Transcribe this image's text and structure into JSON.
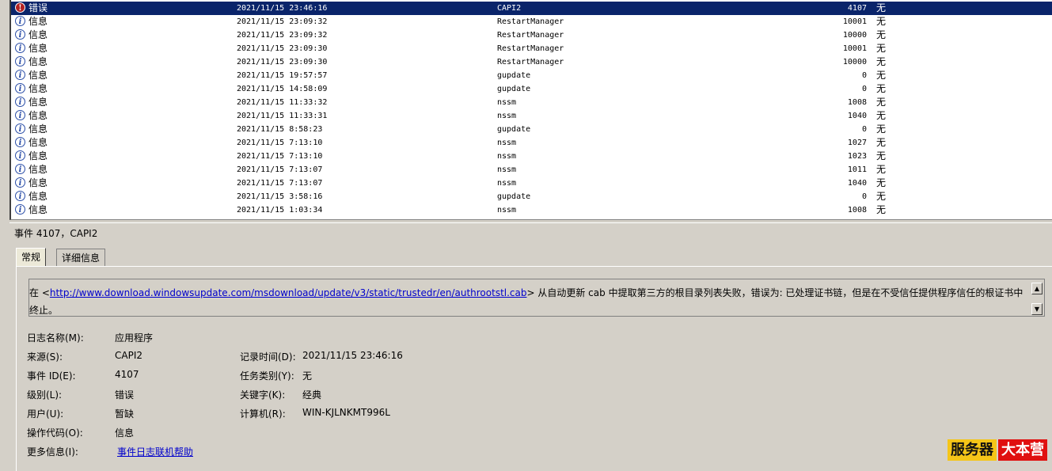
{
  "events": [
    {
      "level": "错误",
      "level_type": "error",
      "date": "2021/11/15 23:46:16",
      "source": "CAPI2",
      "id": "4107",
      "task": "无",
      "selected": true
    },
    {
      "level": "信息",
      "level_type": "info",
      "date": "2021/11/15 23:09:32",
      "source": "RestartManager",
      "id": "10001",
      "task": "无"
    },
    {
      "level": "信息",
      "level_type": "info",
      "date": "2021/11/15 23:09:32",
      "source": "RestartManager",
      "id": "10000",
      "task": "无"
    },
    {
      "level": "信息",
      "level_type": "info",
      "date": "2021/11/15 23:09:30",
      "source": "RestartManager",
      "id": "10001",
      "task": "无"
    },
    {
      "level": "信息",
      "level_type": "info",
      "date": "2021/11/15 23:09:30",
      "source": "RestartManager",
      "id": "10000",
      "task": "无"
    },
    {
      "level": "信息",
      "level_type": "info",
      "date": "2021/11/15 19:57:57",
      "source": "gupdate",
      "id": "0",
      "task": "无"
    },
    {
      "level": "信息",
      "level_type": "info",
      "date": "2021/11/15 14:58:09",
      "source": "gupdate",
      "id": "0",
      "task": "无"
    },
    {
      "level": "信息",
      "level_type": "info",
      "date": "2021/11/15 11:33:32",
      "source": "nssm",
      "id": "1008",
      "task": "无"
    },
    {
      "level": "信息",
      "level_type": "info",
      "date": "2021/11/15 11:33:31",
      "source": "nssm",
      "id": "1040",
      "task": "无"
    },
    {
      "level": "信息",
      "level_type": "info",
      "date": "2021/11/15 8:58:23",
      "source": "gupdate",
      "id": "0",
      "task": "无"
    },
    {
      "level": "信息",
      "level_type": "info",
      "date": "2021/11/15 7:13:10",
      "source": "nssm",
      "id": "1027",
      "task": "无"
    },
    {
      "level": "信息",
      "level_type": "info",
      "date": "2021/11/15 7:13:10",
      "source": "nssm",
      "id": "1023",
      "task": "无"
    },
    {
      "level": "信息",
      "level_type": "info",
      "date": "2021/11/15 7:13:07",
      "source": "nssm",
      "id": "1011",
      "task": "无"
    },
    {
      "level": "信息",
      "level_type": "info",
      "date": "2021/11/15 7:13:07",
      "source": "nssm",
      "id": "1040",
      "task": "无"
    },
    {
      "level": "信息",
      "level_type": "info",
      "date": "2021/11/15 3:58:16",
      "source": "gupdate",
      "id": "0",
      "task": "无"
    },
    {
      "level": "信息",
      "level_type": "info",
      "date": "2021/11/15 1:03:34",
      "source": "nssm",
      "id": "1008",
      "task": "无"
    }
  ],
  "detail": {
    "title": "事件 4107，CAPI2",
    "tabs": {
      "general": "常规",
      "details": "详细信息"
    },
    "message_prefix": "在 <",
    "message_link": "http://www.download.windowsupdate.com/msdownload/update/v3/static/trustedr/en/authrootstl.cab",
    "message_suffix": "> 从自动更新 cab 中提取第三方的根目录列表失败，错误为: 已处理证书链，但是在不受信任提供程序信任的根证书中终止。",
    "fields": {
      "log_name_label": "日志名称(M):",
      "log_name_value": "应用程序",
      "source_label": "来源(S):",
      "source_value": "CAPI2",
      "logged_label": "记录时间(D):",
      "logged_value": "2021/11/15 23:46:16",
      "event_id_label": "事件 ID(E):",
      "event_id_value": "4107",
      "task_label": "任务类别(Y):",
      "task_value": "无",
      "level_label": "级别(L):",
      "level_value": "错误",
      "keywords_label": "关键字(K):",
      "keywords_value": "经典",
      "user_label": "用户(U):",
      "user_value": "暂缺",
      "computer_label": "计算机(R):",
      "computer_value": "WIN-KJLNKMT996L",
      "opcode_label": "操作代码(O):",
      "opcode_value": "信息",
      "more_info_label": "更多信息(I):",
      "more_info_link": "事件日志联机帮助"
    }
  },
  "watermark": {
    "left": "服务器",
    "right": "大本营"
  },
  "colors": {
    "selection": "#0a246a",
    "link": "#0000cc",
    "window_bg": "#d4d0c8"
  }
}
